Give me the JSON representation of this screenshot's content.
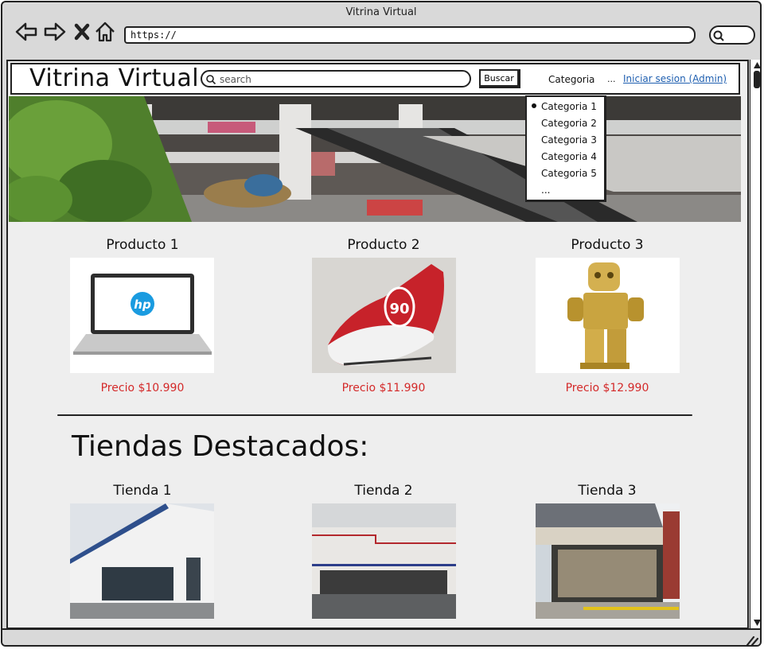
{
  "browser": {
    "title": "Vitrina Virtual",
    "url": "https://"
  },
  "header": {
    "logo": "Vitrina Virtual",
    "search_placeholder": "search",
    "search_button": "Buscar",
    "category_label": "Categoria",
    "ellipsis": "...",
    "login_link": "Iniciar sesion (Admin)"
  },
  "category_menu": {
    "items": [
      "Categoria 1",
      "Categoria 2",
      "Categoria 3",
      "Categoria 4",
      "Categoria 5",
      "..."
    ],
    "selected_index": 0
  },
  "products": [
    {
      "title": "Producto 1",
      "price": "Precio $10.990",
      "image": "laptop-hp"
    },
    {
      "title": "Producto 2",
      "price": "Precio $11.990",
      "image": "soccer-shoe"
    },
    {
      "title": "Producto 3",
      "price": "Precio $12.990",
      "image": "gold-robot-figure"
    }
  ],
  "stores_section": {
    "title": "Tiendas Destacados:",
    "stores": [
      {
        "title": "Tienda 1",
        "image": "store-building-1"
      },
      {
        "title": "Tienda 2",
        "image": "store-building-2"
      },
      {
        "title": "Tienda 3",
        "image": "store-building-3"
      }
    ]
  },
  "colors": {
    "price": "#d42a2a",
    "link": "#1f5fb0",
    "page_background": "#eeeeee",
    "chrome": "#d9d9d9"
  }
}
